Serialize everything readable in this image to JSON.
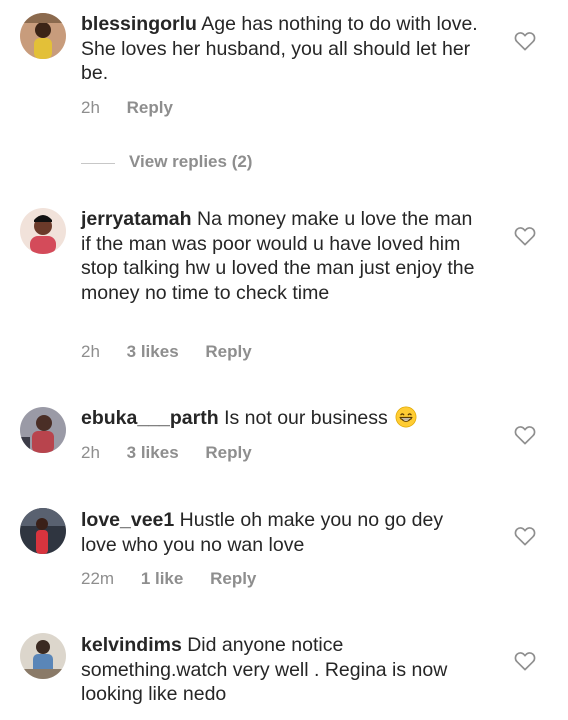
{
  "comments": [
    {
      "username": "blessingorlu",
      "text": "Age has nothing to do with love. She loves her husband, you all should let her be.",
      "time": "2h",
      "likes": "",
      "reply": "Reply",
      "view_replies": "View replies (2)",
      "avatar_color": "#c89c7c",
      "heart_icon": "heart-outline"
    },
    {
      "username": "jerryatamah",
      "text": "Na money make u love the man if the man was poor would u have loved him stop talking hw u loved the man just enjoy the money no time to check time",
      "time": "2h",
      "likes": "3 likes",
      "reply": "Reply",
      "avatar_color": "#d44b5a",
      "heart_icon": "heart-outline"
    },
    {
      "username": "ebuka___parth",
      "text": "Is not our business",
      "emoji": "grinning-face-emoji",
      "time": "2h",
      "likes": "3 likes",
      "reply": "Reply",
      "avatar_color": "#6a6a7a",
      "heart_icon": "heart-outline"
    },
    {
      "username": "love_vee1",
      "text": "Hustle oh make you no go dey love who you no wan love",
      "time": "22m",
      "likes": "1 like",
      "reply": "Reply",
      "avatar_color": "#2f3540",
      "heart_icon": "heart-outline"
    },
    {
      "username": "kelvindims",
      "text": "Did anyone notice something.watch very well . Regina is now looking like nedo",
      "time": "",
      "likes": "",
      "reply": "",
      "avatar_color": "#7a8fa8",
      "heart_icon": "heart-outline"
    }
  ],
  "colors": {
    "text": "#262626",
    "muted": "#8e8e8e",
    "divider": "#c7c7c7"
  }
}
